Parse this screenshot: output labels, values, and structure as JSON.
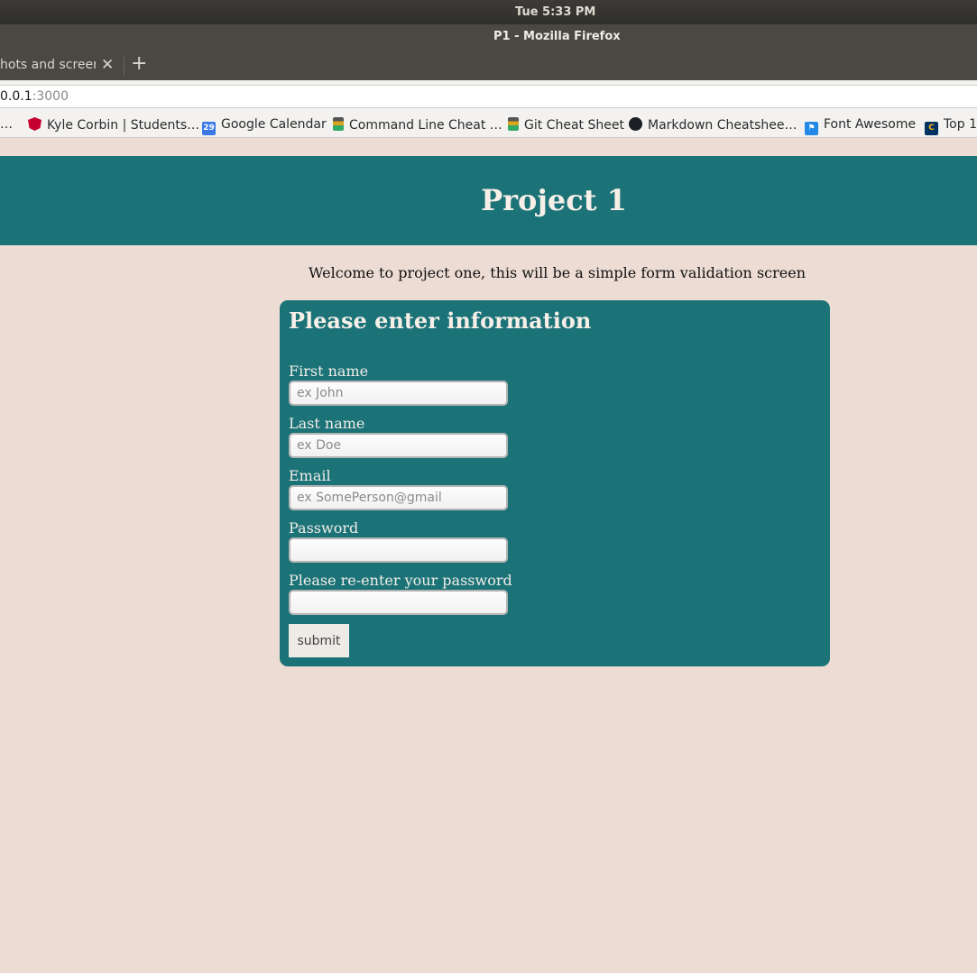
{
  "system": {
    "clock": "Tue  5:33 PM"
  },
  "window": {
    "title": "P1 - Mozilla Firefox"
  },
  "tabs": [
    {
      "label": "hots and screenc"
    }
  ],
  "urlbar": {
    "host": "0.0.1",
    "port": ":3000"
  },
  "bookmarks": [
    {
      "label": "…",
      "icon": "none"
    },
    {
      "label": "Kyle Corbin | Students…",
      "icon": "angular-icon"
    },
    {
      "label": "Google Calendar",
      "icon": "calendar-icon",
      "icon_text": "29"
    },
    {
      "label": "Command Line Cheat …",
      "icon": "cheat-sheet-icon"
    },
    {
      "label": "Git Cheat Sheet",
      "icon": "cheat-sheet-icon"
    },
    {
      "label": "Markdown Cheatshee…",
      "icon": "github-icon"
    },
    {
      "label": "Font Awesome",
      "icon": "flag-icon"
    },
    {
      "label": "Top 1",
      "icon": "cal-icon"
    }
  ],
  "page": {
    "header_title": "Project 1",
    "welcome": "Welcome to project one, this will be a simple form validation screen",
    "form": {
      "heading": "Please enter information",
      "fields": [
        {
          "label": "First name",
          "placeholder": "ex John",
          "value": ""
        },
        {
          "label": "Last name",
          "placeholder": "ex Doe",
          "value": ""
        },
        {
          "label": "Email",
          "placeholder": "ex SomePerson@gmail",
          "value": ""
        },
        {
          "label": "Password",
          "placeholder": "",
          "value": ""
        },
        {
          "label": "Please re-enter your password",
          "placeholder": "",
          "value": ""
        }
      ],
      "submit_label": "submit"
    }
  },
  "colors": {
    "header_bg": "#1b7378",
    "page_bg": "#ecdcd4"
  }
}
